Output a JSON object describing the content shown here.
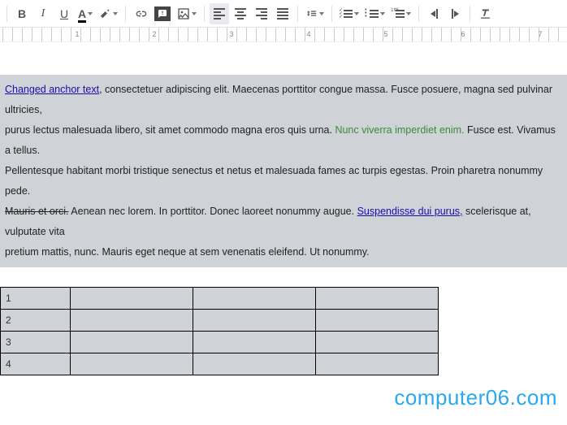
{
  "toolbar": {
    "bold": "B",
    "italic": "I",
    "underline": "U",
    "text_color": "A"
  },
  "ruler": {
    "numbers": [
      "1",
      "2",
      "3",
      "4",
      "5",
      "6",
      "7"
    ]
  },
  "doc": {
    "p1_link": "Changed anchor text",
    "p1_rest": ", consectetuer adipiscing elit. Maecenas porttitor congue massa. Fusce posuere, magna sed pulvinar ultricies,",
    "p2_a": "purus lectus malesuada libero, sit amet commodo magna eros quis urna. ",
    "p2_green": "Nunc viverra imperdiet enim.",
    "p2_b": " Fusce est. Vivamus a tellus.",
    "p3": "Pellentesque habitant morbi tristique senectus et netus et malesuada fames ac turpis egestas. Proin pharetra nonummy pede.",
    "p4_strike": "Mauris et orci.",
    "p4_a": " Aenean nec lorem. In porttitor. Donec laoreet nonummy augue. ",
    "p4_link": "Suspendisse dui purus,",
    "p4_b": " scelerisque at, vulputate vita",
    "p5": "pretium mattis, nunc. Mauris eget neque at sem venenatis eleifend. Ut nonummy."
  },
  "table": {
    "rows": [
      {
        "c1": "1",
        "c2": "",
        "c3": "",
        "c4": ""
      },
      {
        "c1": "2",
        "c2": "",
        "c3": "",
        "c4": ""
      },
      {
        "c1": "3",
        "c2": "",
        "c3": "",
        "c4": ""
      },
      {
        "c1": "4",
        "c2": "",
        "c3": "",
        "c4": ""
      }
    ]
  },
  "watermark": "computer06.com"
}
